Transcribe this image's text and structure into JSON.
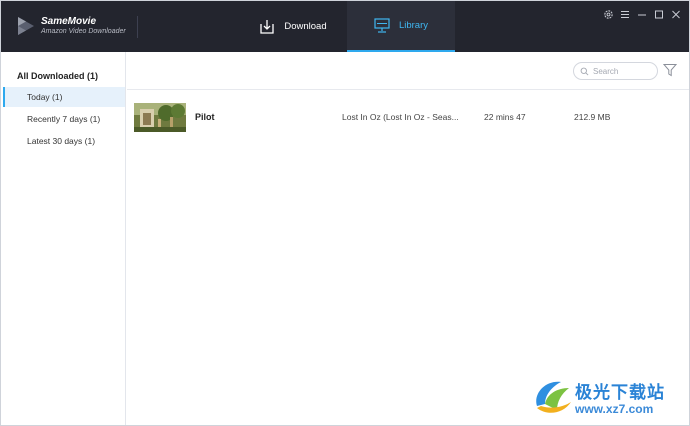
{
  "app": {
    "brand_name": "SameMovie",
    "brand_subtitle": "Amazon Video Downloader"
  },
  "tabs": [
    {
      "label": "Download",
      "icon": "download-icon",
      "active": false
    },
    {
      "label": "Library",
      "icon": "monitor-icon",
      "active": true
    }
  ],
  "window_controls": [
    "gear-icon",
    "menu-icon",
    "minimize-icon",
    "maximize-icon",
    "close-icon"
  ],
  "sidebar": {
    "heading": "All Downloaded (1)",
    "items": [
      {
        "label": "Today (1)",
        "active": true
      },
      {
        "label": "Recently 7 days (1)",
        "active": false
      },
      {
        "label": "Latest 30 days (1)",
        "active": false
      }
    ]
  },
  "search": {
    "placeholder": "Search",
    "value": ""
  },
  "videos": [
    {
      "title": "Pilot",
      "series": "Lost In Oz (Lost In Oz - Seas...",
      "duration": "22 mins 47",
      "size": "212.9 MB"
    }
  ],
  "watermark": {
    "text": "极光下载站",
    "url": "www.xz7.com"
  },
  "colors": {
    "header_bg": "#23252e",
    "accent": "#2ea9ee",
    "active_tab_text": "#3fb6f0",
    "sidebar_active_bg": "#e6f1fb"
  }
}
